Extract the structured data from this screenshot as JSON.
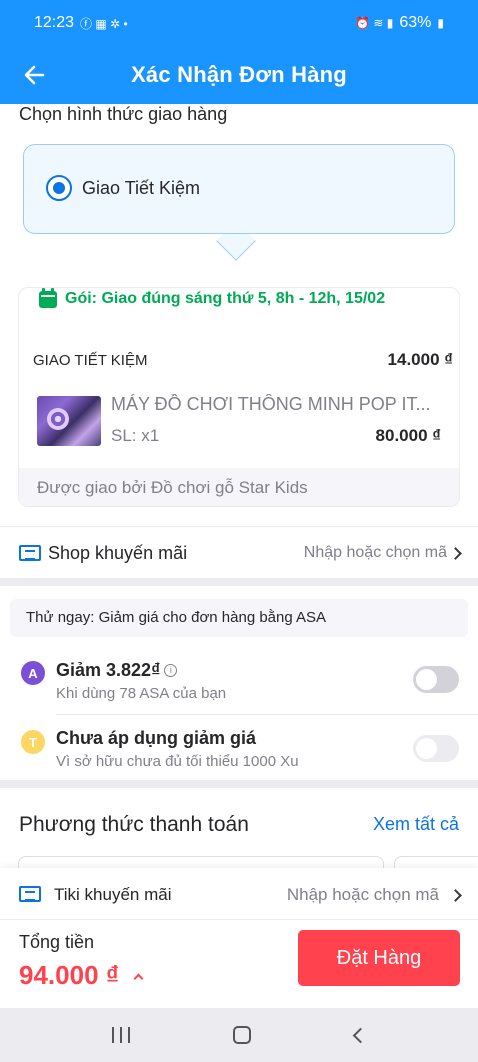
{
  "status_bar": {
    "time": "12:23",
    "battery": "63%"
  },
  "header": {
    "title": "Xác Nhận Đơn Hàng"
  },
  "delivery": {
    "section_title": "Chọn hình thức giao hàng",
    "option_label": "Giao Tiết Kiệm"
  },
  "package": {
    "schedule": "Gói: Giao đúng sáng thứ 5, 8h - 12h, 15/02",
    "method": "GIAO TIẾT KIỆM",
    "shipping_fee": "14.000 ₫",
    "product_name": "MÁY ĐỒ CHƠI THÔNG MINH POP IT...",
    "quantity": "SL: x1",
    "price": "80.000 ₫",
    "seller": "Được giao bởi Đồ chơi gỗ Star Kids"
  },
  "shop_promo": {
    "label": "Shop khuyến mãi",
    "hint": "Nhập hoặc chọn mã"
  },
  "asa": {
    "banner": "Thử ngay: Giảm giá cho đơn hàng bằng ASA",
    "asa_title": "Giảm 3.822₫",
    "asa_sub": "Khi dùng 78 ASA của bạn",
    "xu_title": "Chưa áp dụng giảm giá",
    "xu_sub": "Vì sở hữu chưa đủ tối thiểu 1000 Xu"
  },
  "payment": {
    "title": "Phương thức thanh toán",
    "see_all": "Xem tất cả"
  },
  "tiki_promo": {
    "label": "Tiki khuyến mãi",
    "hint": "Nhập hoặc chọn mã"
  },
  "footer": {
    "total_label": "Tổng tiền",
    "total_value": "94.000 ₫",
    "order_button": "Đặt Hàng"
  },
  "colors": {
    "primary": "#1a94ff",
    "accent_red": "#ff424e",
    "green": "#00ab56"
  },
  "icons": [
    "back-arrow-icon",
    "radio-selected-icon",
    "calendar-icon",
    "ticket-icon",
    "chevron-right-icon",
    "asa-coin-icon",
    "xu-coin-icon",
    "info-icon",
    "caret-up-icon"
  ]
}
